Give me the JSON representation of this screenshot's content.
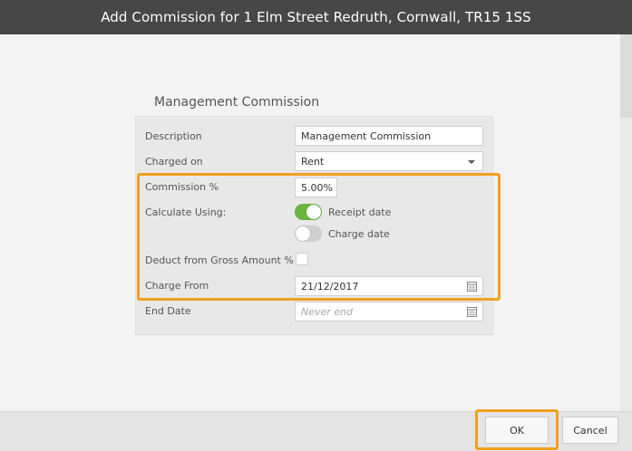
{
  "dialog": {
    "title": "Add Commission for 1 Elm Street Redruth, Cornwall, TR15 1SS"
  },
  "section": {
    "title": "Management Commission"
  },
  "form": {
    "description_label": "Description",
    "description_value": "Management Commission",
    "charged_on_label": "Charged on",
    "charged_on_value": "Rent",
    "commission_label": "Commission %",
    "commission_value": "5.00%",
    "calculate_label": "Calculate Using:",
    "receipt_date_label": "Receipt date",
    "receipt_date_on": true,
    "charge_date_label": "Charge date",
    "charge_date_on": false,
    "deduct_label": "Deduct from Gross Amount %",
    "deduct_checked": false,
    "charge_from_label": "Charge From",
    "charge_from_value": "21/12/2017",
    "end_date_label": "End Date",
    "end_date_placeholder": "Never end"
  },
  "footer": {
    "ok_label": "OK",
    "cancel_label": "Cancel"
  },
  "colors": {
    "title_bar": "#474747",
    "toggle_on": "#6cb33e",
    "highlight": "#f0a020"
  }
}
